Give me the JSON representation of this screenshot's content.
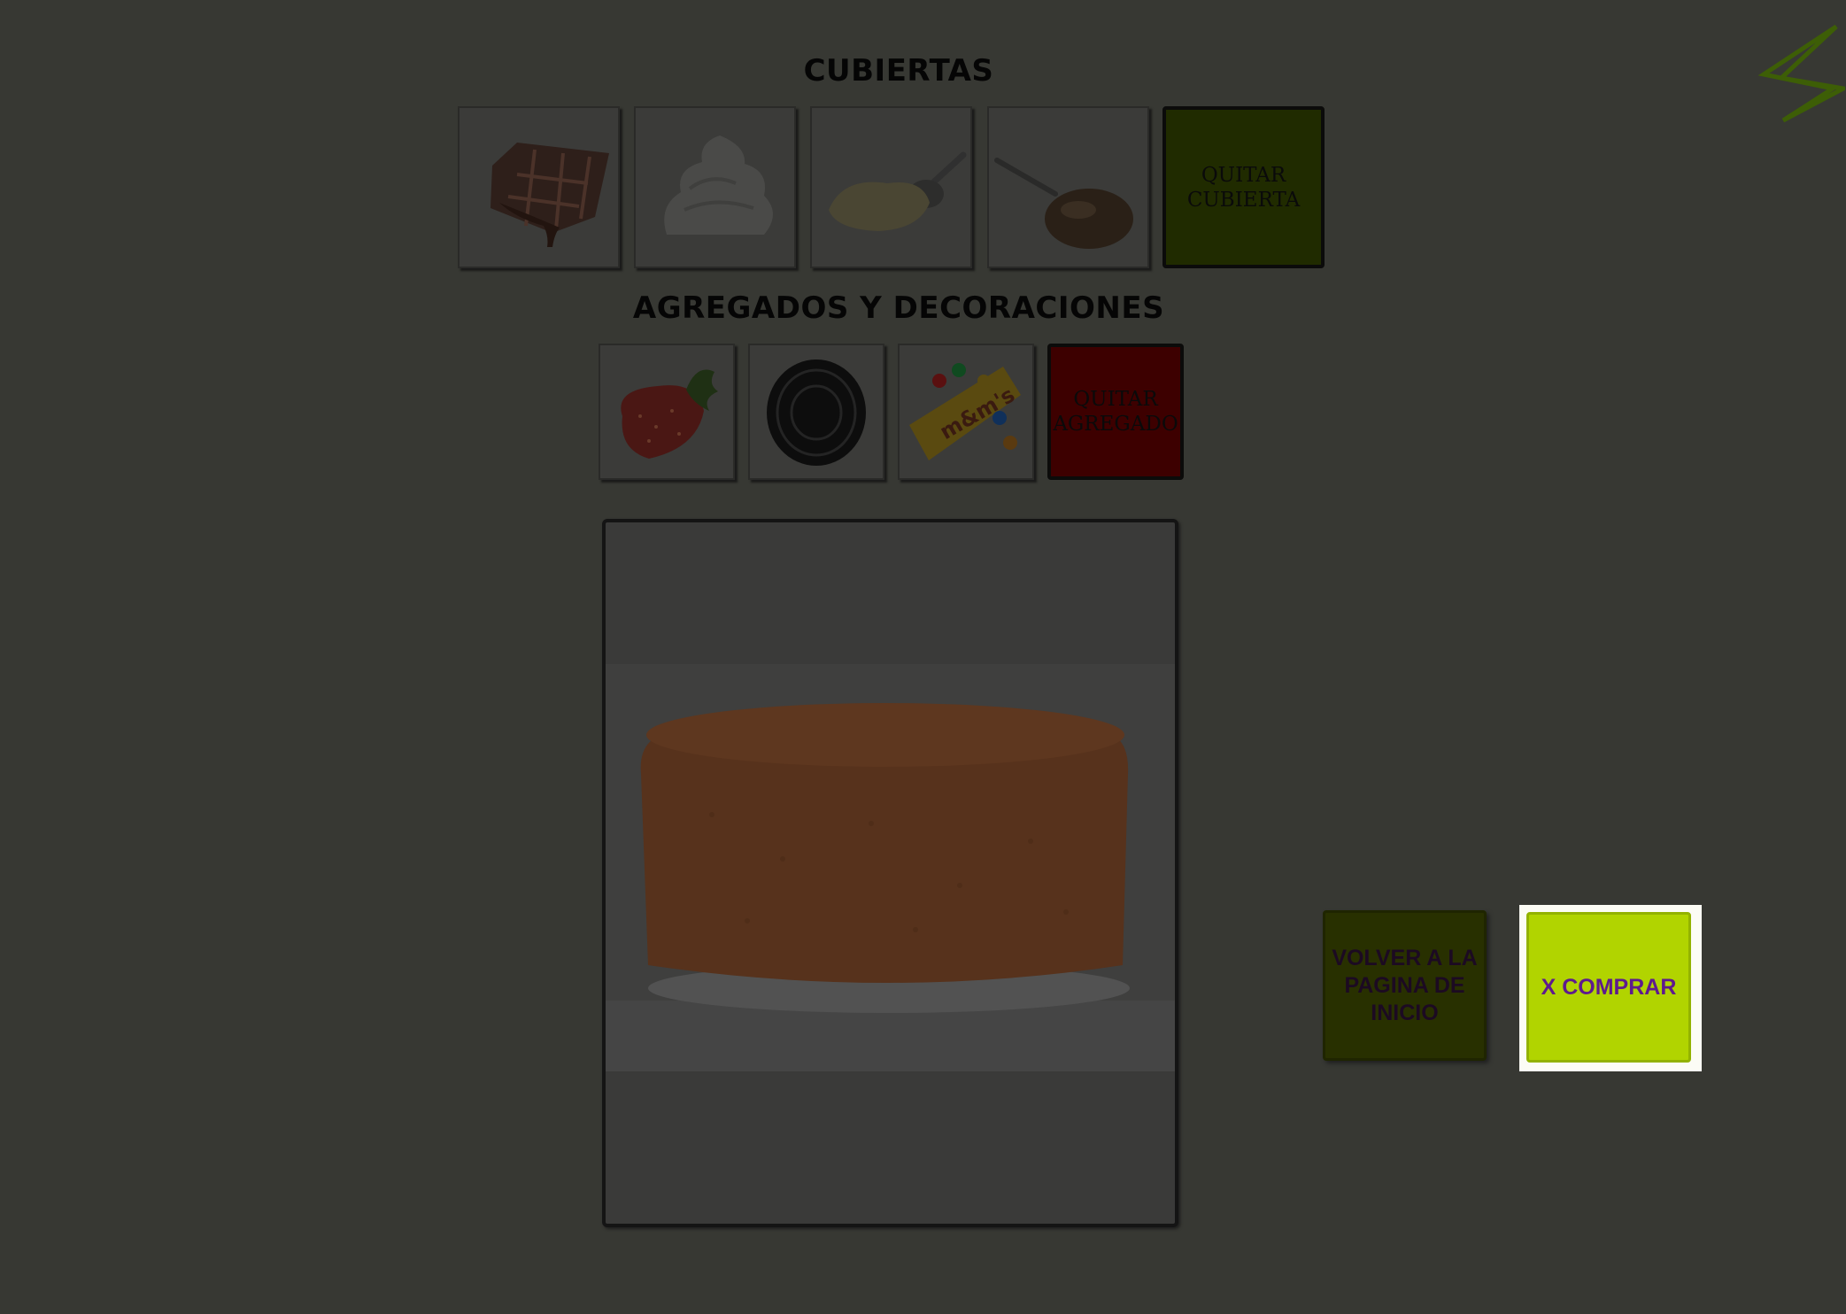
{
  "coverings": {
    "title": "CUBIERTAS",
    "items": [
      {
        "icon": "chocolate-bar-icon"
      },
      {
        "icon": "whipped-cream-icon"
      },
      {
        "icon": "vanilla-cream-spoon-icon"
      },
      {
        "icon": "dulce-de-leche-spoon-icon"
      }
    ],
    "remove_label": "QUITAR CUBIERTA"
  },
  "addons": {
    "title": "AGREGADOS Y DECORACIONES",
    "items": [
      {
        "icon": "strawberry-icon"
      },
      {
        "icon": "cookie-icon"
      },
      {
        "icon": "candy-bag-icon"
      }
    ],
    "remove_label": "QUITAR AGREGADO"
  },
  "preview": {
    "icon": "sponge-cake-image"
  },
  "nav": {
    "back_label": "VOLVER A LA PAGINA DE INICIO",
    "buy_label": "X COMPRAR"
  },
  "logo": {
    "icon": "chevron-logo-icon"
  },
  "colors": {
    "background": "#373833",
    "quit_cover": "#202b00",
    "quit_addon": "#3d0000",
    "back_button": "#283000",
    "buy_button": "#b1d400",
    "buy_text": "#5e1a8e"
  }
}
